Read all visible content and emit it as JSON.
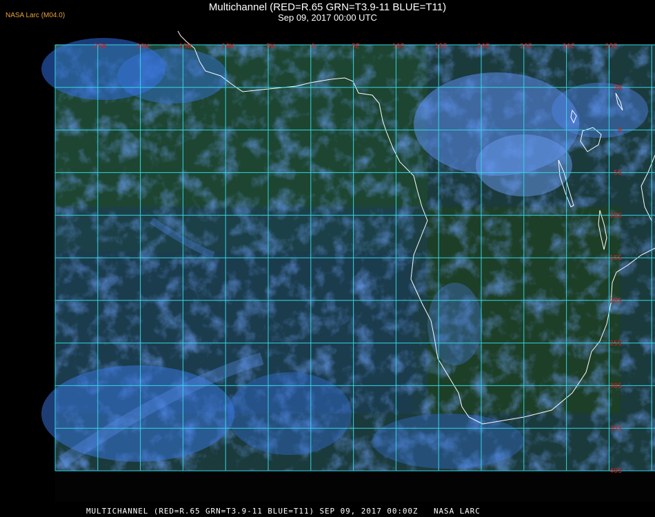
{
  "header": {
    "logo": "NASA Larc (M04.0)",
    "title": "Multichannel (RED=R.65 GRN=T3.9-11 BLUE=T11)",
    "subtitle": "Sep 09, 2017 00:00 UTC"
  },
  "map": {
    "longitude_labels": [
      "25W",
      "20W",
      "15W",
      "10W",
      "5W",
      "0",
      "5E",
      "10E",
      "15E",
      "20E",
      "25E",
      "30E",
      "35E"
    ],
    "latitude_labels": [
      "5N",
      "0",
      "5S",
      "10S",
      "15S",
      "20S",
      "25S",
      "30S",
      "35S",
      "40S"
    ],
    "grid_color": "#33d6e6",
    "label_color": "#d42020",
    "coastline_color": "#ffffff"
  },
  "footer": {
    "text": "MULTICHANNEL (RED=R.65 GRN=T3.9-11 BLUE=T11) SEP 09, 2017 00:00Z   NASA LARC"
  }
}
